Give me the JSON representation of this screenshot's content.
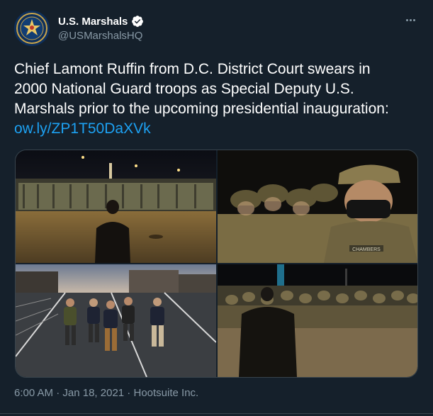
{
  "account": {
    "display_name": "U.S. Marshals",
    "handle": "@USMarshalsHQ",
    "verified": true,
    "avatar_icon": "us-marshals-badge-icon"
  },
  "tweet": {
    "line1": "Chief Lamont Ruffin from D.C. District Court swears in",
    "line2": "2000 National Guard troops as Special Deputy U.S.",
    "line3": "Marshals prior to the upcoming presidential inauguration:",
    "link": "ow.ly/ZP1T50DaXVk"
  },
  "photos": {
    "tile2_nametape": "CHAMBERS"
  },
  "footer": {
    "time": "6:00 AM",
    "separator": " · ",
    "date": "Jan 18, 2021",
    "source": "Hootsuite Inc."
  },
  "colors": {
    "background": "#15202b",
    "text": "#ffffff",
    "secondary": "#8899a6",
    "link": "#1da1f2",
    "border": "#38444d"
  }
}
